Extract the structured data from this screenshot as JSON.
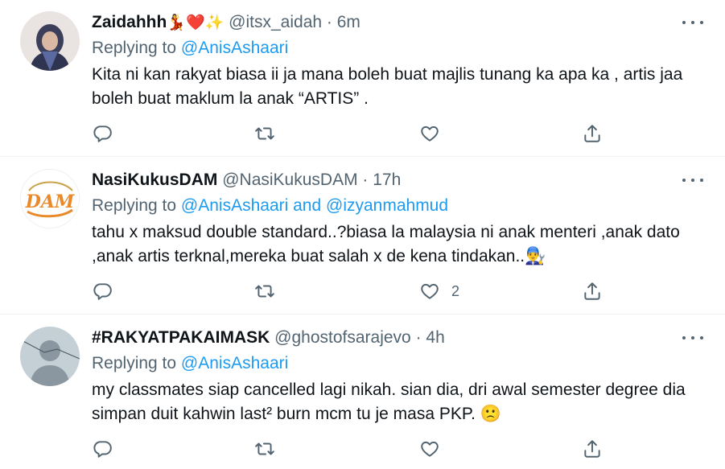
{
  "tweets": [
    {
      "name": "Zaidahhh",
      "name_emoji": "💃❤️✨",
      "handle": "@itsx_aidah",
      "time": "6m",
      "replying_prefix": "Replying to ",
      "replying_to": "@AnisAshaari",
      "replying_joiner": "",
      "replying_to_2": "",
      "text": "Kita ni kan rakyat biasa ii ja mana boleh buat majlis tunang ka apa ka , artis jaa boleh buat maklum la anak “ARTIS” .",
      "like_count": ""
    },
    {
      "name": "NasiKukusDAM",
      "name_emoji": "",
      "handle": "@NasiKukusDAM",
      "time": "17h",
      "replying_prefix": "Replying to ",
      "replying_to": "@AnisAshaari",
      "replying_joiner": " and ",
      "replying_to_2": "@izyanmahmud",
      "text": "tahu x maksud double standard..?biasa la malaysia ni anak menteri ,anak dato ,anak artis terknal,mereka buat salah x de kena tindakan..👨‍🔧",
      "like_count": "2"
    },
    {
      "name": "#RAKYATPAKAIMASK",
      "name_emoji": "",
      "handle": "@ghostofsarajevo",
      "time": "4h",
      "replying_prefix": "Replying to ",
      "replying_to": "@AnisAshaari",
      "replying_joiner": "",
      "replying_to_2": "",
      "text": "my classmates siap cancelled lagi nikah. sian dia, dri awal semester degree dia simpan duit kahwin last² burn mcm tu je masa PKP. 🙁",
      "like_count": ""
    }
  ],
  "separator": " · ",
  "logo_text": "DAM",
  "colors": {
    "accent": "#1d9bf0",
    "secondary": "#536471",
    "border": "#eff3f4"
  },
  "icons": [
    "reply-icon",
    "retweet-icon",
    "like-icon",
    "share-icon",
    "more-icon"
  ]
}
